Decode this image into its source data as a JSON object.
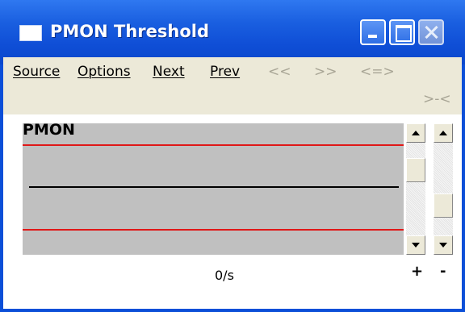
{
  "window": {
    "title": "PMON Threshold"
  },
  "menubar": {
    "items": [
      {
        "label": "Source",
        "disabled": false
      },
      {
        "label": "Options",
        "disabled": false
      },
      {
        "label": "Next",
        "disabled": false
      },
      {
        "label": "Prev",
        "disabled": false
      },
      {
        "label": "<<",
        "disabled": true
      },
      {
        "label": ">>",
        "disabled": true
      },
      {
        "label": "<=>",
        "disabled": true
      },
      {
        "label": ">-<",
        "disabled": true
      }
    ]
  },
  "graph": {
    "label": "PMON",
    "colors": {
      "background": "#c0c0c0",
      "threshold_lines": "#e01818",
      "value_line": "#000000"
    }
  },
  "footer": {
    "rate": "0/s",
    "plus": "+",
    "minus": "-"
  }
}
